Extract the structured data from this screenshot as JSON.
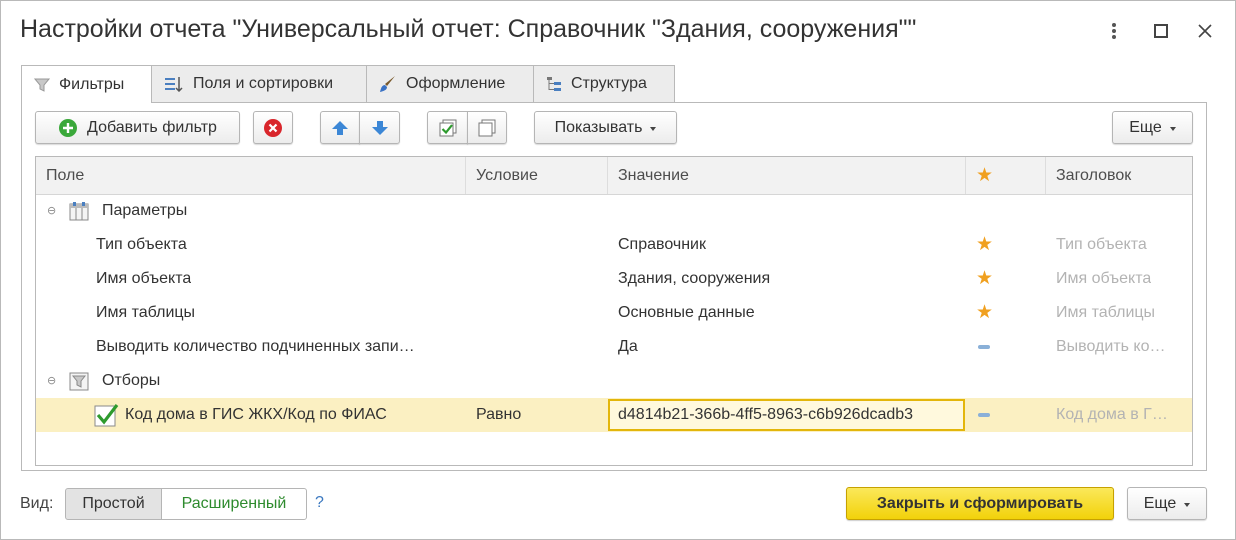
{
  "window": {
    "title": "Настройки отчета \"Универсальный отчет: Справочник \"Здания, сооружения\"\""
  },
  "tabs": [
    {
      "label": "Фильтры",
      "icon": "filter-icon",
      "active": true
    },
    {
      "label": "Поля и сортировки",
      "icon": "fields-sort-icon",
      "active": false
    },
    {
      "label": "Оформление",
      "icon": "brush-icon",
      "active": false
    },
    {
      "label": "Структура",
      "icon": "structure-icon",
      "active": false
    }
  ],
  "toolbar": {
    "add_filter_label": "Добавить фильтр",
    "show_label": "Показывать",
    "more_label": "Еще"
  },
  "table": {
    "columns": [
      "Поле",
      "Условие",
      "Значение",
      "★",
      "Заголовок"
    ],
    "groups": [
      {
        "label": "Параметры",
        "rows": [
          {
            "field": "Тип объекта",
            "condition": "",
            "value": "Справочник",
            "mark": "star",
            "title": "Тип объекта"
          },
          {
            "field": "Имя объекта",
            "condition": "",
            "value": "Здания, сооружения",
            "mark": "star",
            "title": "Имя объекта"
          },
          {
            "field": "Имя таблицы",
            "condition": "",
            "value": "Основные данные",
            "mark": "star",
            "title": "Имя таблицы"
          },
          {
            "field": "Выводить количество подчиненных запи…",
            "condition": "",
            "value": "Да",
            "mark": "dash",
            "title": "Выводить ко…"
          }
        ]
      },
      {
        "label": "Отборы",
        "rows": [
          {
            "field": "Код дома в ГИС ЖКХ/Код по ФИАС",
            "condition": "Равно",
            "value": "d4814b21-366b-4ff5-8963-c6b926dcadb3",
            "mark": "dash",
            "title": "Код дома в Г…",
            "checked": true,
            "selected": true
          }
        ]
      }
    ]
  },
  "footer": {
    "view_label": "Вид:",
    "simple_label": "Простой",
    "extended_label": "Расширенный",
    "help_label": "?",
    "primary_label": "Закрыть и сформировать",
    "more_label": "Еще"
  },
  "colors": {
    "primary_button": "#f2d20a",
    "selected_row": "#fbf0c2",
    "star": "#f0a020",
    "extended_text": "#2e8b2e"
  }
}
